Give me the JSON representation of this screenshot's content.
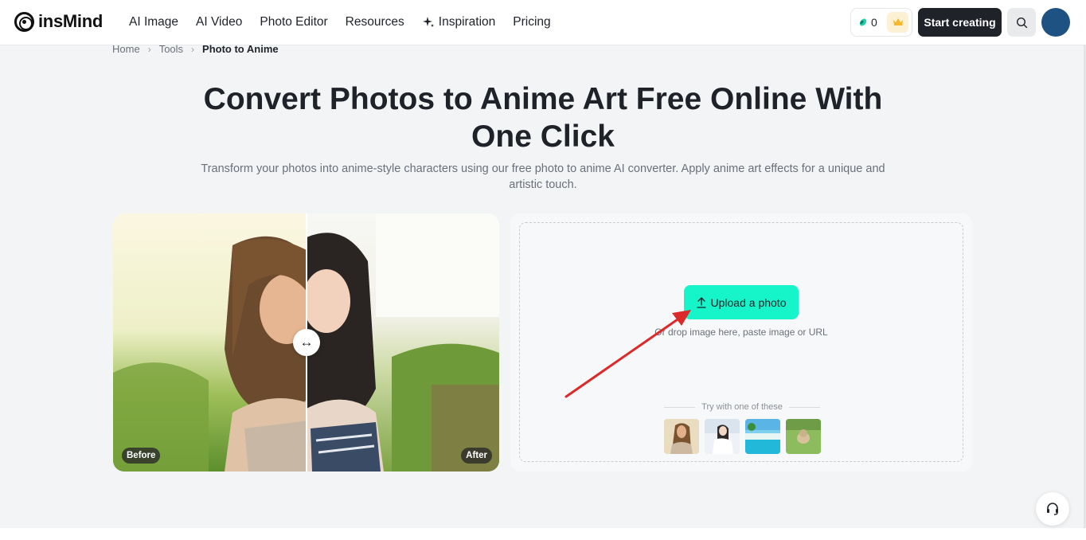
{
  "brand": {
    "name": "insMind"
  },
  "nav": {
    "items": [
      {
        "label": "AI Image"
      },
      {
        "label": "AI Video"
      },
      {
        "label": "Photo Editor"
      },
      {
        "label": "Resources"
      },
      {
        "label": "Inspiration",
        "icon": "sparkle-icon"
      },
      {
        "label": "Pricing"
      }
    ]
  },
  "header": {
    "credits": "0",
    "start_label": "Start creating",
    "search_icon": "search-icon",
    "crown_icon": "crown-icon"
  },
  "breadcrumb": {
    "items": [
      "Home",
      "Tools",
      "Photo to Anime"
    ]
  },
  "hero": {
    "title": "Convert Photos to Anime Art Free Online With One Click",
    "subtitle": "Transform your photos into anime-style characters using our free photo to anime AI converter. Apply anime art effects for a unique and artistic touch."
  },
  "compare": {
    "before_label": "Before",
    "after_label": "After",
    "handle_icon": "arrows-horizontal-icon",
    "colors": {
      "accent": "#16f4c9"
    }
  },
  "upload": {
    "button_label": "Upload a photo",
    "hint": "Or drop image here, paste image or URL",
    "try_label": "Try with one of these",
    "samples": [
      "portrait-sample",
      "seated-girl-sample",
      "pool-sample",
      "dog-sample"
    ]
  }
}
